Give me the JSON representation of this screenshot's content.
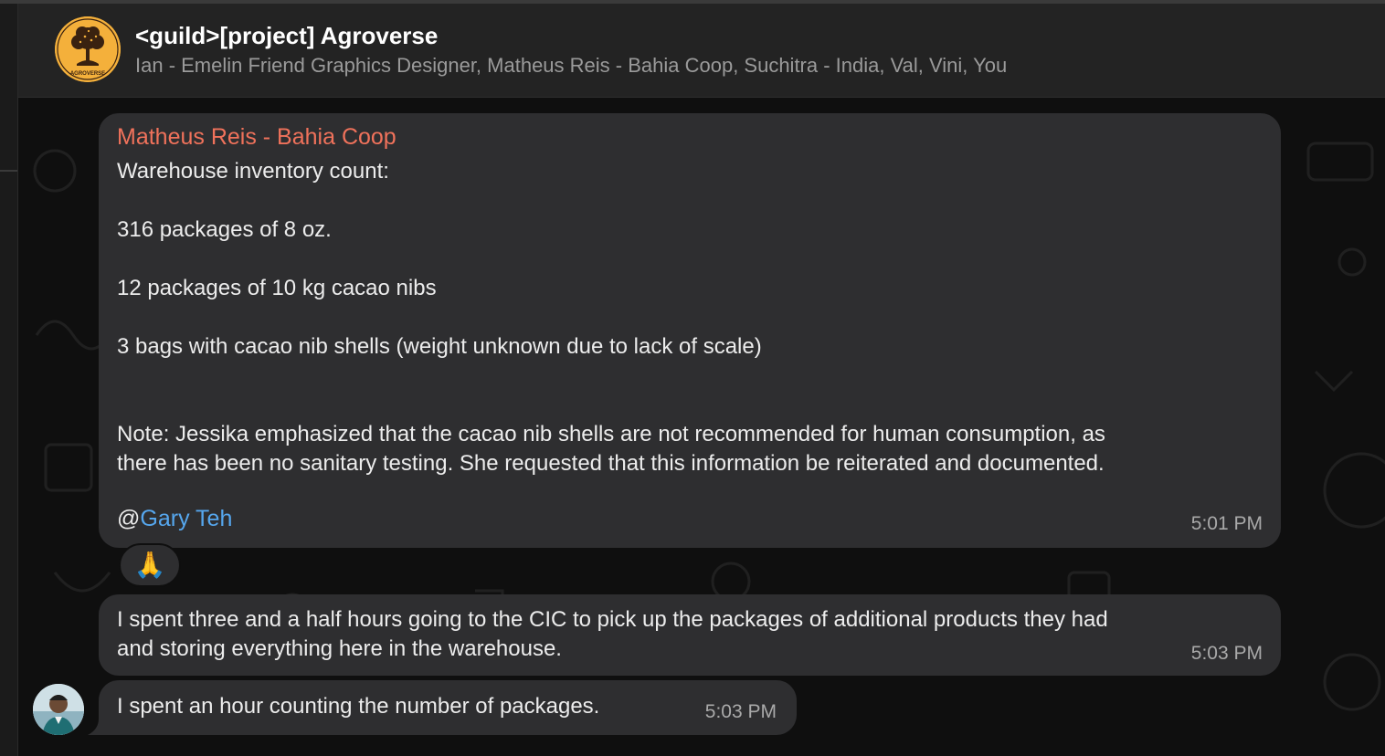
{
  "header": {
    "title": "<guild>[project] Agroverse",
    "members": "Ian - Emelin Friend Graphics Designer, Matheus Reis - Bahia Coop, Suchitra - India, Val, Vini, You",
    "avatar_logo_text": "AGROVERSE"
  },
  "messages": [
    {
      "sender": "Matheus Reis - Bahia Coop",
      "lines": [
        "Warehouse inventory count:",
        "316 packages of 8 oz.",
        "12 packages of 10 kg cacao nibs",
        "3 bags with cacao nib shells (weight unknown due to lack of scale)",
        "Note: Jessika emphasized that the cacao nib shells are not recommended for human consumption, as",
        "there has been no sanitary testing. She requested that this information be reiterated and documented."
      ],
      "mention_prefix": "@",
      "mention_name": "Gary Teh",
      "time": "5:01 PM",
      "reaction": "🙏"
    },
    {
      "lines": [
        "I spent three and a half hours going to the CIC to pick up the packages of additional products they had",
        "and storing everything here in the warehouse."
      ],
      "time": "5:03 PM"
    },
    {
      "lines": [
        "I spent an hour counting the number of packages."
      ],
      "time": "5:03 PM"
    }
  ],
  "colors": {
    "sender_name": "#f0725b",
    "mention": "#56a7ee",
    "bubble": "#2e2e30",
    "header_bg": "#232323",
    "group_avatar_bg": "#f4b03b"
  },
  "icons": {
    "group_avatar": "agroverse-tree-logo",
    "user_avatar": "user-photo"
  }
}
